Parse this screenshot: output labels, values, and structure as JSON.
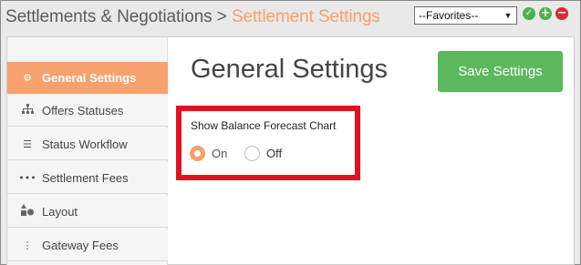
{
  "breadcrumb": {
    "parent": "Settlements & Negotiations",
    "separator": " > ",
    "current": "Settlement Settings"
  },
  "favorites": {
    "selected": "--Favorites--"
  },
  "header_icons": [
    "check-icon",
    "plus-icon",
    "minus-icon"
  ],
  "sidebar": {
    "items": [
      {
        "label": "General Settings",
        "icon": "gears-icon",
        "active": true
      },
      {
        "label": "Offers Statuses",
        "icon": "sitemap-icon",
        "active": false
      },
      {
        "label": "Status Workflow",
        "icon": "list-icon",
        "active": false
      },
      {
        "label": "Settlement Fees",
        "icon": "ellipsis-icon",
        "active": false
      },
      {
        "label": "Layout",
        "icon": "shapes-icon",
        "active": false
      },
      {
        "label": "Gateway Fees",
        "icon": "vertical-ellipsis-icon",
        "active": false
      }
    ]
  },
  "main": {
    "title": "General Settings",
    "save_label": "Save Settings",
    "setting": {
      "label": "Show Balance Forecast Chart",
      "options": [
        {
          "label": "On",
          "selected": true
        },
        {
          "label": "Off",
          "selected": false
        }
      ]
    }
  },
  "colors": {
    "accent": "#f7a06a",
    "save_button": "#5cb85c",
    "highlight_border": "#e0131f"
  }
}
